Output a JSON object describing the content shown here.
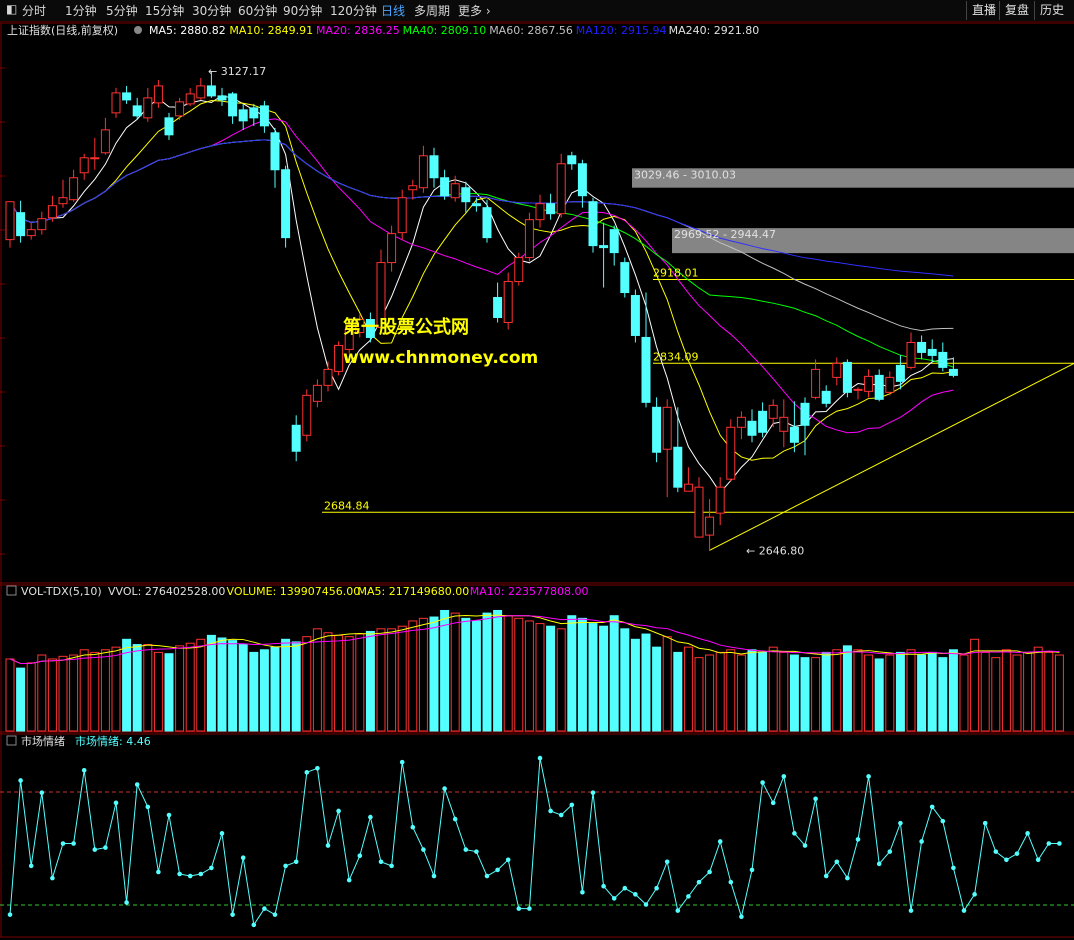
{
  "toolbar": {
    "items": [
      "分时",
      "1分钟",
      "5分钟",
      "15分钟",
      "30分钟",
      "60分钟",
      "90分钟",
      "120分钟",
      "日线",
      "多周期",
      "更多"
    ],
    "active": "日线",
    "right": [
      "直播",
      "复盘",
      "历史"
    ]
  },
  "price_header": {
    "name": "上证指数(日线,前复权)",
    "ma": [
      {
        "label": "MA5: 2880.82",
        "color": "#ffffff"
      },
      {
        "label": "MA10: 2849.91",
        "color": "#ffff00"
      },
      {
        "label": "MA20: 2836.25",
        "color": "#ff00ff"
      },
      {
        "label": "MA40: 2809.10",
        "color": "#00ff00"
      },
      {
        "label": "MA60: 2867.56",
        "color": "#c0c0c0"
      },
      {
        "label": "MA120: 2915.94",
        "color": "#2020ff"
      },
      {
        "label": "MA240: 2921.80",
        "color": "#e0e0e0"
      }
    ]
  },
  "vol_header": {
    "name": "VOL-TDX(5,10)",
    "items": [
      {
        "label": "VVOL: 276402528.00",
        "color": "#e0e0e0"
      },
      {
        "label": "VOLUME: 139907456.00",
        "color": "#ffff00"
      },
      {
        "label": "MA5: 217149680.00",
        "color": "#ffff00"
      },
      {
        "label": "MA10: 223577808.00",
        "color": "#ff00ff"
      }
    ]
  },
  "sent_header": {
    "name": "市场情绪",
    "label": "市场情绪: 4.46"
  },
  "watermark": {
    "line1": "第一股票公式网",
    "line2": "www.chnmoney.com"
  },
  "colors": {
    "up": "#ff3232",
    "down": "#54ffff",
    "grid": "#7a0000",
    "bg": "#000000"
  },
  "chart_data": {
    "type": "candlestick",
    "ylim": [
      2615,
      3160
    ],
    "annotations": {
      "high": "3127.17",
      "low": "2646.80",
      "low2": "2684.84",
      "gap1": "3029.46 - 3010.03",
      "gap2": "2969.52 - 2944.47",
      "level1": "2918.01",
      "level2": "2834.09"
    },
    "levels": [
      {
        "label": "2918.01",
        "value": 2918.01
      },
      {
        "label": "2834.09",
        "value": 2834.09
      },
      {
        "label": "2684.84",
        "value": 2684.84
      }
    ],
    "gaps": [
      {
        "label": "3029.46 - 3010.03",
        "low": 3010.03,
        "high": 3029.46
      },
      {
        "label": "2969.52 - 2944.47",
        "low": 2944.47,
        "high": 2969.52
      }
    ],
    "candles": [
      [
        2958,
        2996,
        2991,
        2950
      ],
      [
        2985,
        2962,
        2997,
        2955
      ],
      [
        2962,
        2968,
        2975,
        2958
      ],
      [
        2968,
        2979,
        2986,
        2963
      ],
      [
        2980,
        2992,
        3002,
        2976
      ],
      [
        2994,
        3000,
        3018,
        2990
      ],
      [
        2998,
        3020,
        3028,
        2996
      ],
      [
        3025,
        3040,
        3044,
        3018
      ],
      [
        3040,
        3040,
        3060,
        3028
      ],
      [
        3045,
        3068,
        3080,
        3043
      ],
      [
        3085,
        3105,
        3110,
        3080
      ],
      [
        3105,
        3098,
        3112,
        3094
      ],
      [
        3092,
        3082,
        3100,
        3078
      ],
      [
        3080,
        3100,
        3110,
        3076
      ],
      [
        3095,
        3112,
        3118,
        3090
      ],
      [
        3080,
        3063,
        3085,
        3058
      ],
      [
        3082,
        3096,
        3100,
        3078
      ],
      [
        3094,
        3104,
        3110,
        3092
      ],
      [
        3100,
        3112,
        3120,
        3098
      ],
      [
        3112,
        3102,
        3127,
        3100
      ],
      [
        3102,
        3098,
        3110,
        3092
      ],
      [
        3104,
        3082,
        3106,
        3074
      ],
      [
        3088,
        3077,
        3094,
        3068
      ],
      [
        3090,
        3080,
        3094,
        3072
      ],
      [
        3092,
        3072,
        3097,
        3065
      ],
      [
        3065,
        3028,
        3070,
        3010
      ],
      [
        3028,
        2960,
        3032,
        2950
      ],
      [
        2772,
        2746,
        2782,
        2736
      ],
      [
        2762,
        2802,
        2808,
        2756
      ],
      [
        2796,
        2812,
        2818,
        2790
      ],
      [
        2812,
        2828,
        2836,
        2806
      ],
      [
        2826,
        2852,
        2856,
        2822
      ],
      [
        2848,
        2868,
        2874,
        2844
      ],
      [
        2865,
        2878,
        2883,
        2860
      ],
      [
        2878,
        2860,
        2885,
        2855
      ],
      [
        2870,
        2935,
        2948,
        2866
      ],
      [
        2935,
        2964,
        2972,
        2926
      ],
      [
        2965,
        3000,
        3008,
        2958
      ],
      [
        3008,
        3012,
        3018,
        2998
      ],
      [
        3010,
        3042,
        3052,
        3005
      ],
      [
        3042,
        3020,
        3050,
        3010
      ],
      [
        3020,
        3002,
        3028,
        2998
      ],
      [
        3000,
        3014,
        3022,
        2996
      ],
      [
        3010,
        2996,
        3016,
        2985
      ],
      [
        2994,
        2992,
        3000,
        2986
      ],
      [
        2990,
        2960,
        2998,
        2955
      ],
      [
        2900,
        2880,
        2915,
        2875
      ],
      [
        2875,
        2916,
        2925,
        2868
      ],
      [
        2916,
        2940,
        2945,
        2912
      ],
      [
        2940,
        2978,
        2985,
        2936
      ],
      [
        2978,
        2994,
        3003,
        2970
      ],
      [
        2994,
        2984,
        3004,
        2978
      ],
      [
        2984,
        3034,
        3044,
        2980
      ],
      [
        3042,
        3034,
        3046,
        3028
      ],
      [
        3034,
        3002,
        3038,
        2990
      ],
      [
        2996,
        2952,
        3000,
        2945
      ],
      [
        2952,
        2950,
        2975,
        2910
      ],
      [
        2968,
        2945,
        2972,
        2932
      ],
      [
        2935,
        2905,
        2940,
        2900
      ],
      [
        2902,
        2862,
        2908,
        2855
      ],
      [
        2860,
        2795,
        2905,
        2790
      ],
      [
        2790,
        2745,
        2800,
        2735
      ],
      [
        2748,
        2790,
        2798,
        2700
      ],
      [
        2750,
        2710,
        2790,
        2705
      ],
      [
        2706,
        2713,
        2730,
        2706
      ],
      [
        2660,
        2710,
        2720,
        2660
      ],
      [
        2662,
        2680,
        2698,
        2646
      ],
      [
        2684,
        2710,
        2720,
        2672
      ],
      [
        2718,
        2770,
        2778,
        2716
      ],
      [
        2770,
        2780,
        2786,
        2758
      ],
      [
        2776,
        2762,
        2788,
        2755
      ],
      [
        2786,
        2765,
        2795,
        2760
      ],
      [
        2779,
        2792,
        2798,
        2770
      ],
      [
        2766,
        2780,
        2798,
        2750
      ],
      [
        2770,
        2755,
        2796,
        2745
      ],
      [
        2794,
        2772,
        2800,
        2742
      ],
      [
        2800,
        2828,
        2838,
        2798
      ],
      [
        2806,
        2794,
        2812,
        2790
      ],
      [
        2820,
        2834,
        2840,
        2812
      ],
      [
        2835,
        2805,
        2838,
        2800
      ],
      [
        2808,
        2808,
        2810,
        2798
      ],
      [
        2806,
        2821,
        2828,
        2800
      ],
      [
        2822,
        2798,
        2828,
        2796
      ],
      [
        2805,
        2820,
        2826,
        2802
      ],
      [
        2832,
        2816,
        2842,
        2808
      ],
      [
        2830,
        2855,
        2865,
        2828
      ],
      [
        2855,
        2845,
        2862,
        2838
      ],
      [
        2848,
        2842,
        2858,
        2835
      ],
      [
        2845,
        2830,
        2855,
        2826
      ],
      [
        2828,
        2822,
        2840,
        2820
      ]
    ],
    "volume": [
      55,
      48,
      52,
      58,
      55,
      57,
      58,
      62,
      60,
      62,
      64,
      70,
      66,
      66,
      60,
      59,
      65,
      67,
      70,
      73,
      71,
      69,
      66,
      60,
      62,
      64,
      70,
      68,
      72,
      78,
      75,
      73,
      72,
      74,
      76,
      78,
      78,
      80,
      84,
      86,
      87,
      92,
      90,
      86,
      84,
      90,
      92,
      88,
      86,
      84,
      82,
      80,
      78,
      88,
      86,
      82,
      80,
      88,
      78,
      70,
      74,
      64,
      72,
      60,
      64,
      56,
      58,
      60,
      62,
      58,
      62,
      60,
      64,
      60,
      58,
      56,
      56,
      60,
      62,
      65,
      62,
      58,
      55,
      58,
      60,
      62,
      58,
      60,
      56,
      62,
      58,
      70,
      60,
      56,
      62,
      58,
      60,
      64,
      60,
      58
    ],
    "sentiment": [
      1.0,
      7.6,
      3.4,
      7.0,
      2.8,
      4.5,
      4.5,
      8.1,
      4.2,
      4.3,
      6.5,
      1.6,
      7.4,
      6.3,
      3.1,
      5.9,
      3.0,
      2.9,
      3.0,
      3.3,
      5.0,
      1.0,
      3.8,
      0.5,
      1.3,
      1.0,
      3.4,
      3.6,
      8.0,
      8.2,
      4.4,
      6.1,
      2.7,
      3.9,
      5.8,
      3.6,
      3.4,
      8.5,
      5.3,
      4.2,
      2.9,
      7.2,
      5.7,
      4.2,
      4.1,
      2.9,
      3.2,
      3.7,
      1.3,
      1.3,
      8.7,
      6.1,
      5.9,
      6.4,
      2.1,
      7.0,
      2.4,
      1.8,
      2.3,
      2.0,
      1.5,
      2.3,
      3.6,
      1.2,
      1.9,
      2.6,
      3.1,
      4.6,
      2.6,
      0.9,
      3.2,
      7.5,
      6.5,
      7.8,
      5.0,
      4.4,
      6.7,
      2.9,
      3.6,
      2.8,
      4.7,
      7.8,
      3.5,
      4.1,
      5.5,
      1.2,
      4.6,
      6.3,
      5.6,
      3.3,
      1.2,
      2.0,
      5.5,
      4.1,
      3.7,
      4.0,
      5.0,
      3.7,
      4.5,
      4.5
    ]
  }
}
